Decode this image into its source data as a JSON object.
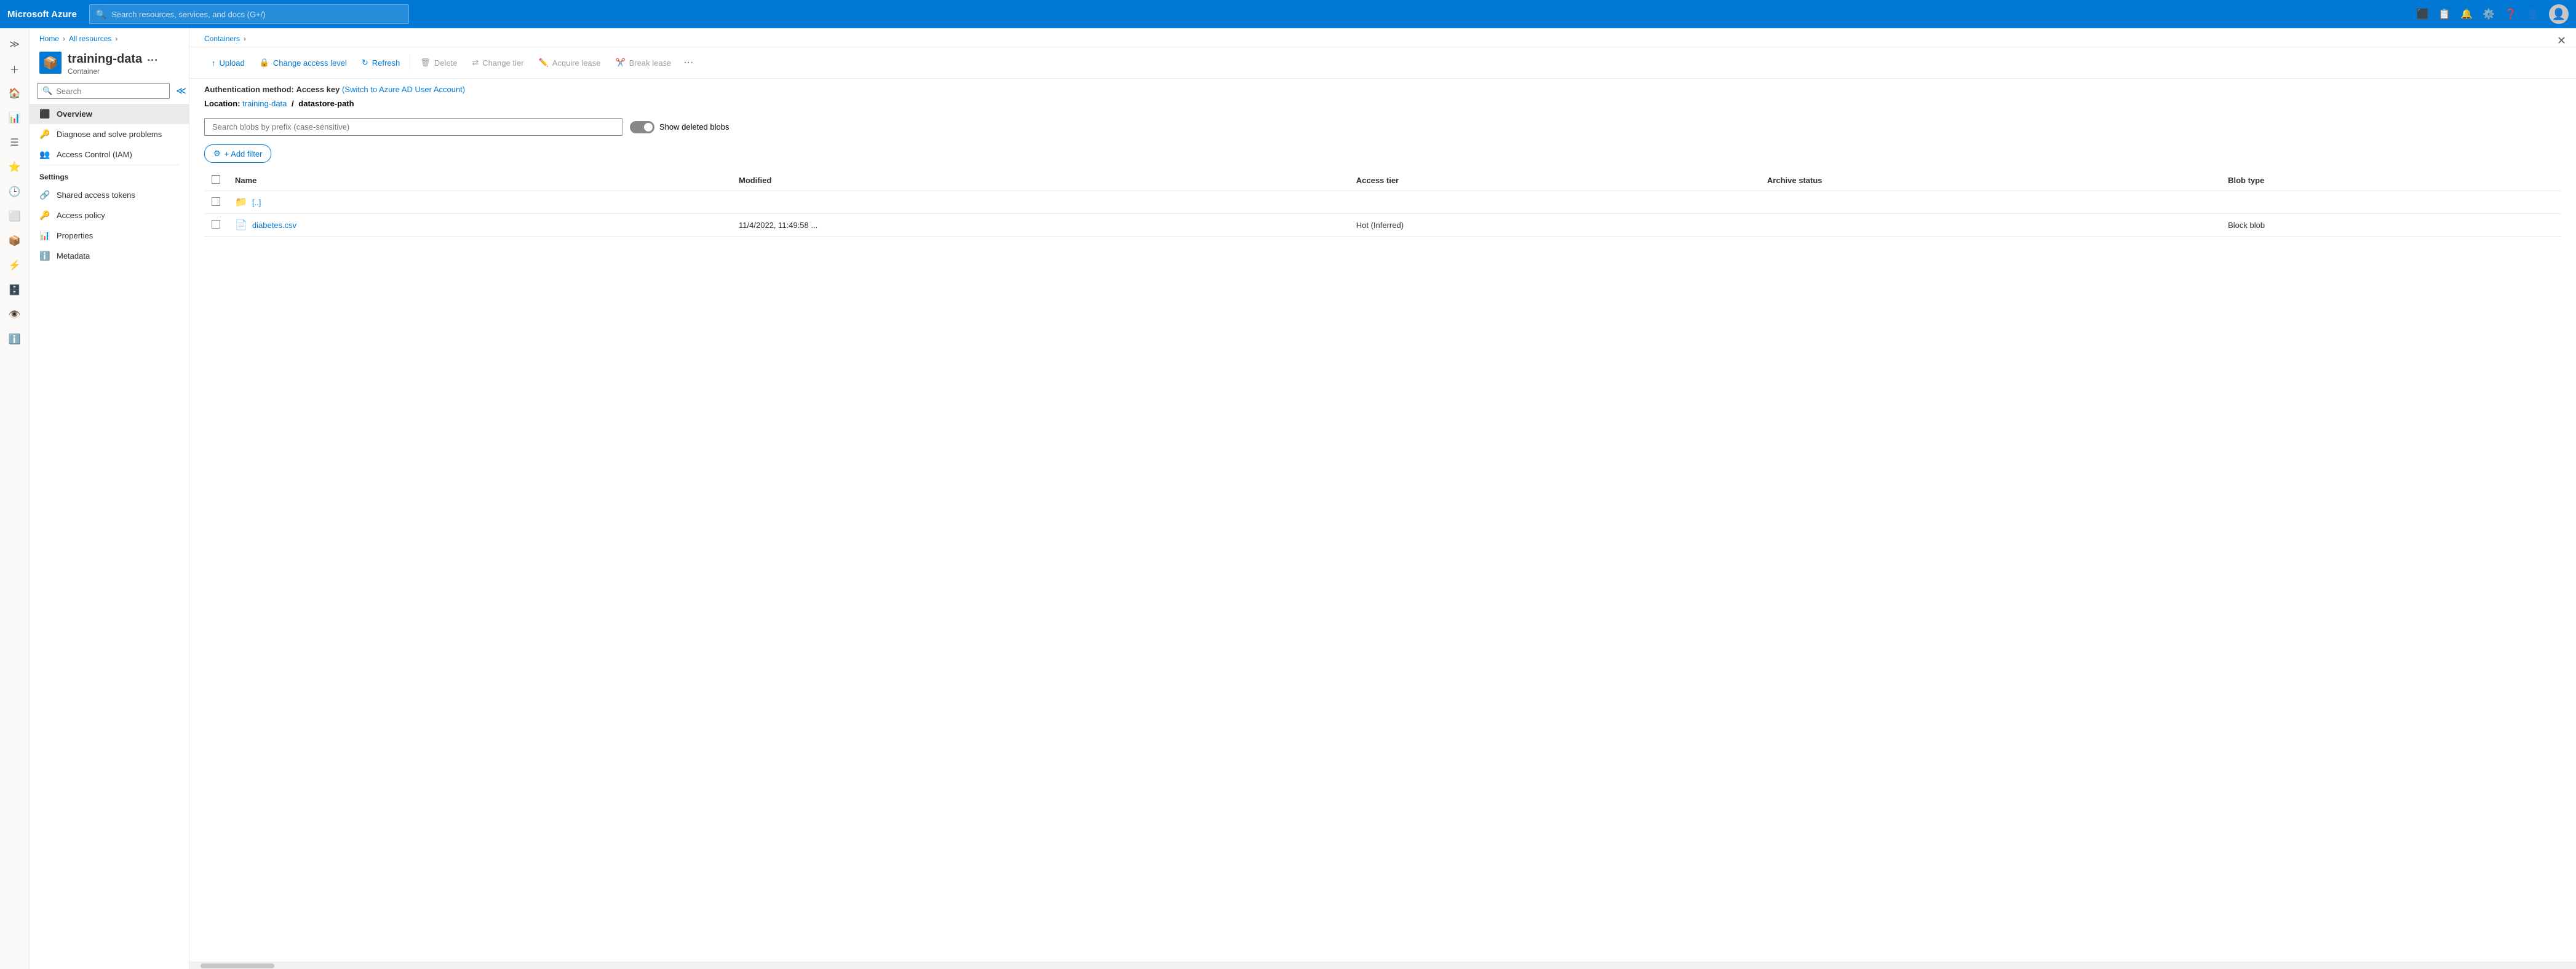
{
  "topbar": {
    "brand": "Microsoft Azure",
    "search_placeholder": "Search resources, services, and docs (G+/)",
    "icons": [
      "terminal-icon",
      "feedback-icon",
      "bell-icon",
      "settings-icon",
      "help-icon",
      "account-icon"
    ]
  },
  "breadcrumb": {
    "home": "Home",
    "all_resources": "All resources",
    "containers": "Containers"
  },
  "resource": {
    "title": "training-data",
    "subtitle": "Container"
  },
  "left_search": {
    "placeholder": "Search"
  },
  "nav": {
    "overview": "Overview",
    "diagnose": "Diagnose and solve problems",
    "access_control": "Access Control (IAM)",
    "settings_label": "Settings",
    "shared_access_tokens": "Shared access tokens",
    "access_policy": "Access policy",
    "properties": "Properties",
    "metadata": "Metadata"
  },
  "toolbar": {
    "upload": "Upload",
    "change_access_level": "Change access level",
    "refresh": "Refresh",
    "delete": "Delete",
    "change_tier": "Change tier",
    "acquire_lease": "Acquire lease",
    "break_lease": "Break lease"
  },
  "auth": {
    "label": "Authentication method:",
    "value": "Access key",
    "link_text": "(Switch to Azure AD User Account)"
  },
  "location": {
    "label": "Location:",
    "path": "training-data",
    "separator": "/",
    "subpath": "datastore-path"
  },
  "search_blobs": {
    "placeholder": "Search blobs by prefix (case-sensitive)"
  },
  "show_deleted": "Show deleted blobs",
  "add_filter": "+ Add filter",
  "table": {
    "columns": [
      "Name",
      "Modified",
      "Access tier",
      "Archive status",
      "Blob type"
    ],
    "rows": [
      {
        "name": "[..]",
        "modified": "",
        "access_tier": "",
        "archive_status": "",
        "blob_type": "",
        "icon": "📁",
        "is_folder": true
      },
      {
        "name": "diabetes.csv",
        "modified": "11/4/2022, 11:49:58 ...",
        "access_tier": "Hot (Inferred)",
        "archive_status": "",
        "blob_type": "Block blob",
        "icon": "📄",
        "is_folder": false
      }
    ]
  }
}
